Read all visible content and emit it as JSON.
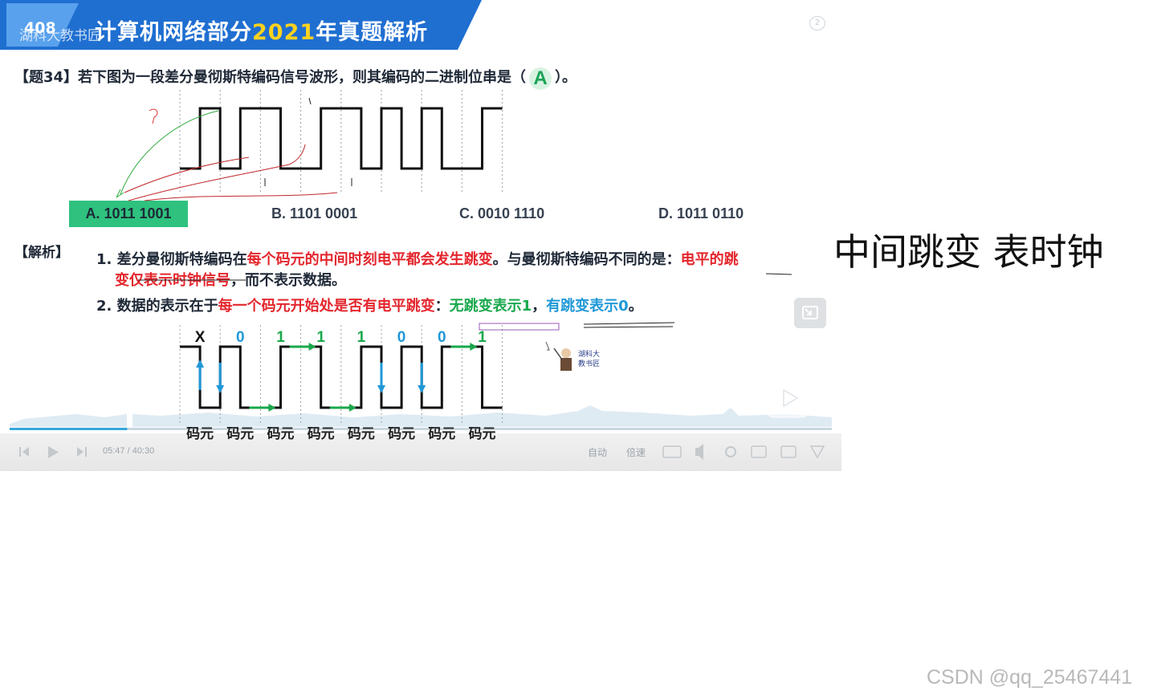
{
  "banner": {
    "num": "408",
    "watermark": "湖科大教书匠",
    "title_prefix": "计算机网络部分",
    "title_year": "2021",
    "title_suffix": "年真题解析",
    "colors": {
      "primary": "#1f6fd1",
      "accent_year": "#ffd21e"
    }
  },
  "question": {
    "prefix": "【题34】若下图为一段差分曼彻斯特编码信号波形，则其编码的二进制位串是（",
    "answer": "A",
    "suffix": "）。"
  },
  "options": [
    {
      "label": "A. 1011 1001",
      "selected": true
    },
    {
      "label": "B. 1101 0001",
      "selected": false
    },
    {
      "label": "C. 0010 1110",
      "selected": false
    },
    {
      "label": "D. 1011 0110",
      "selected": false
    }
  ],
  "analysis": {
    "label": "【解析】",
    "p1_a": "1. 差分曼彻斯特编码在",
    "p1_b": "每个码元的中间时刻电平都会发生跳变",
    "p1_c": "。与曼彻斯特编码不同的是：",
    "p1_d": "电平的跳",
    "p1_e": "变仅表示时钟信号",
    "p1_f": "，而不表示数据。",
    "p2_a": "2. 数据的表示在于",
    "p2_b": "每一个码元开始处是否有电平跳变",
    "p2_c": "：",
    "p2_d": "无跳变表示1",
    "p2_e": "，",
    "p2_f": "有跳变表示0",
    "p2_g": "。"
  },
  "bits": [
    "X",
    "0",
    "1",
    "1",
    "1",
    "0",
    "0",
    "1"
  ],
  "cell_label": "码元",
  "mascot": {
    "line1": "湖科大",
    "line2": "教书匠"
  },
  "player": {
    "time": "05:47 / 40:30",
    "auto": "自动",
    "speed": "倍速",
    "progress_fraction": 0.143
  },
  "note": "中间跳变 表时钟",
  "watermark": "CSDN @qq_25467441"
}
